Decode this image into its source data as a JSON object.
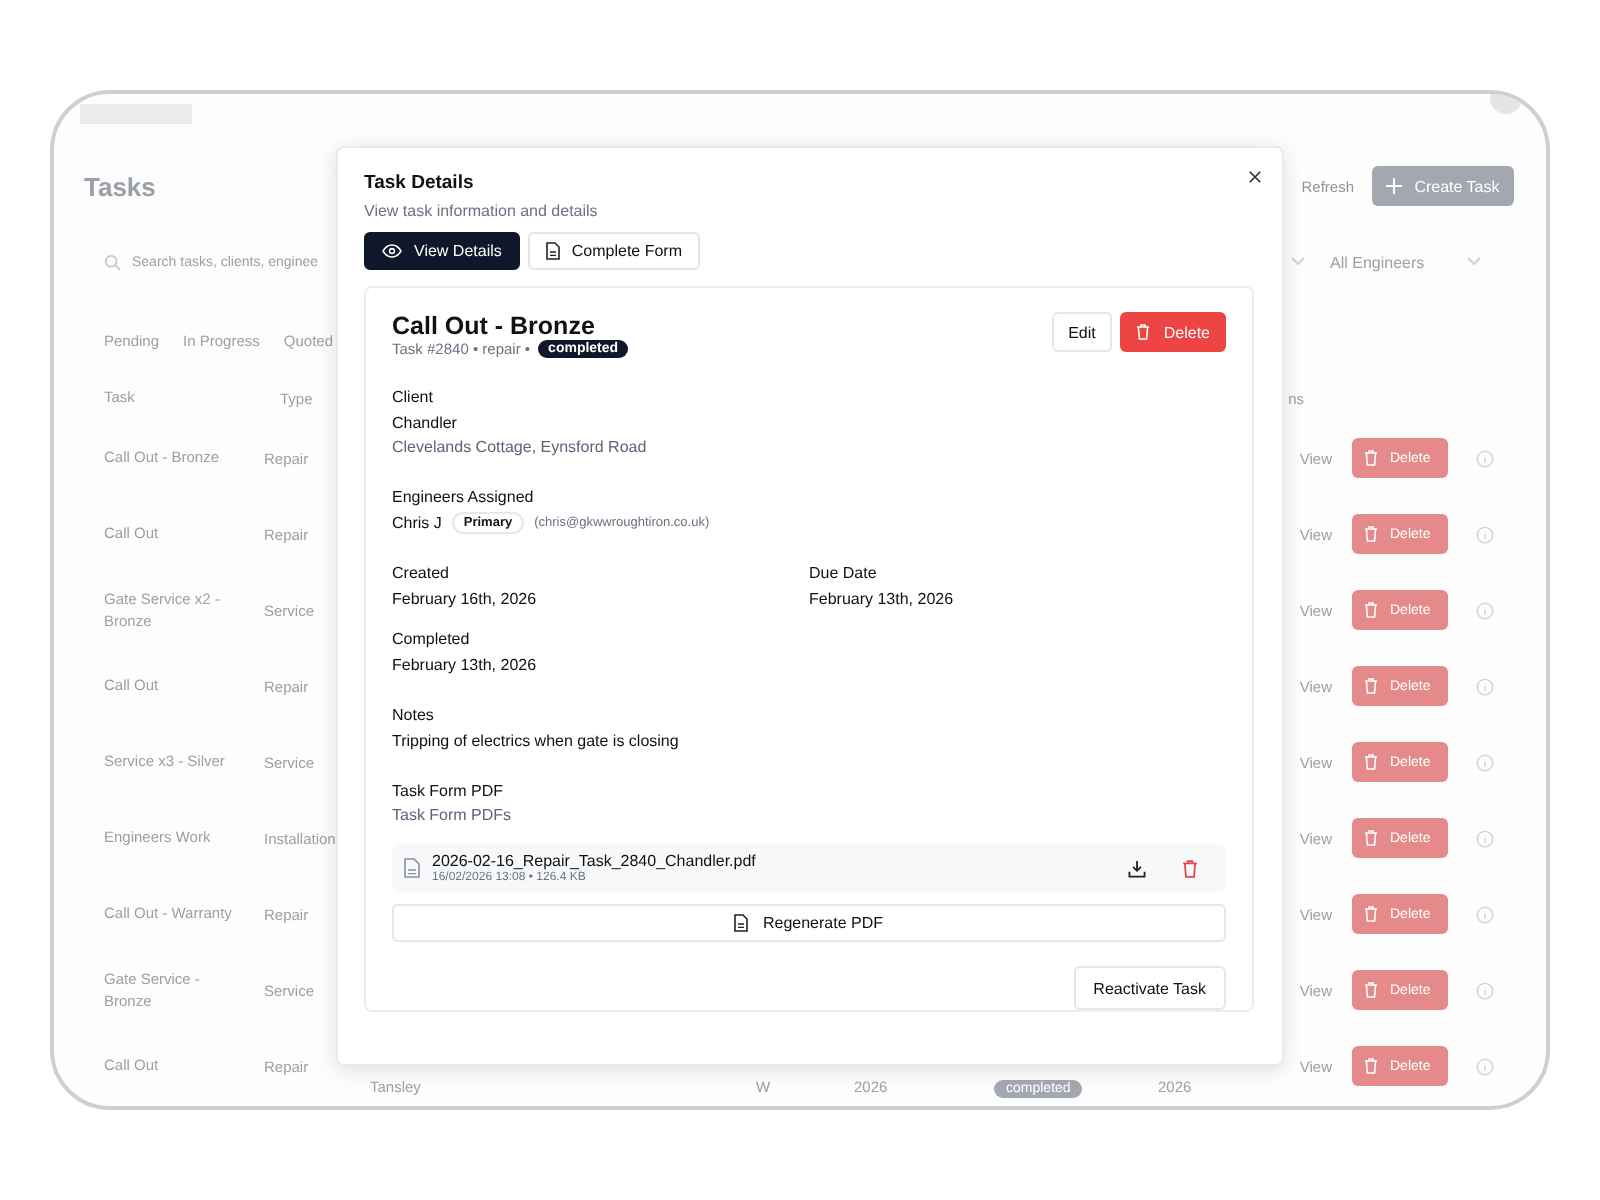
{
  "page": {
    "title": "Tasks",
    "refresh": "Refresh",
    "create_button": "Create Task",
    "search": {
      "placeholder": "Search tasks, clients, enginee"
    },
    "engineer_filter": "All Engineers",
    "status_tabs": [
      "Pending",
      "In Progress",
      "Quoted"
    ],
    "table": {
      "columns": [
        "Task",
        "Type",
        "ns"
      ],
      "rows": [
        {
          "task": "Call Out - Bronze",
          "type": "Repair",
          "view": "View",
          "delete": "Delete"
        },
        {
          "task": "Call Out",
          "type": "Repair",
          "view": "View",
          "delete": "Delete"
        },
        {
          "task": "Gate Service x2 - Bronze",
          "type": "Service",
          "view": "View",
          "delete": "Delete"
        },
        {
          "task": "Call Out",
          "type": "Repair",
          "view": "View",
          "delete": "Delete"
        },
        {
          "task": "Service x3 - Silver",
          "type": "Service",
          "view": "View",
          "delete": "Delete"
        },
        {
          "task": "Engineers Work",
          "type": "Installation",
          "view": "View",
          "delete": "Delete"
        },
        {
          "task": "Call Out - Warranty",
          "type": "Repair",
          "view": "View",
          "delete": "Delete"
        },
        {
          "task": "Gate Service - Bronze",
          "type": "Service",
          "view": "View",
          "delete": "Delete"
        },
        {
          "task": "Call Out",
          "type": "Repair",
          "client": "Tansley",
          "engineer": "W",
          "created": "2026",
          "status": "completed",
          "due": "2026",
          "view": "View",
          "delete": "Delete"
        }
      ]
    }
  },
  "modal": {
    "title": "Task Details",
    "subtitle": "View task information and details",
    "tabs": [
      {
        "label": "View Details",
        "kind": "view",
        "selected": true
      },
      {
        "label": "Complete Form",
        "kind": "form",
        "selected": false
      }
    ],
    "task": {
      "name": "Call Out - Bronze",
      "meta": "Task #2840 • repair •",
      "status": "completed",
      "edit": "Edit",
      "delete": "Delete",
      "client_label": "Client",
      "client": "Chandler",
      "address": "Clevelands Cottage, Eynsford Road",
      "engineers_label": "Engineers Assigned",
      "engineer": "Chris J",
      "engineer_role": "Primary",
      "engineer_email": "(chris@gkwwroughtiron.co.uk)",
      "dates": [
        {
          "label": "Created",
          "value": "February 16th, 2026"
        },
        {
          "label": "Due Date",
          "value": "February 13th, 2026"
        },
        {
          "label": "Completed",
          "value": "February 13th, 2026"
        }
      ],
      "notes_label": "Notes",
      "notes": "Tripping of electrics when gate is closing",
      "pdf_label": "Task Form PDF",
      "pdf_sublabel": "Task Form PDFs",
      "files": [
        {
          "name": "2026-02-16_Repair_Task_2840_Chandler.pdf",
          "meta": "16/02/2026 13:08 • 126.4 KB"
        }
      ],
      "regenerate": "Regenerate PDF",
      "reactivate": "Reactivate Task"
    }
  }
}
